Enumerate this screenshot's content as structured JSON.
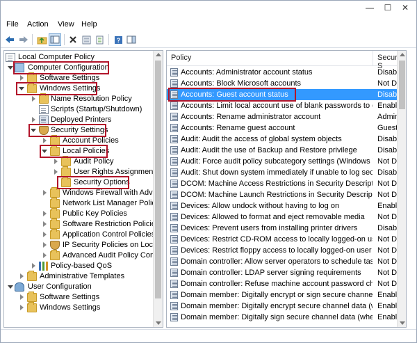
{
  "window": {
    "min_glyph": "—",
    "max_glyph": "☐",
    "close_glyph": "✕"
  },
  "menu": [
    "File",
    "Action",
    "View",
    "Help"
  ],
  "tree": {
    "root": "Local Computer Policy",
    "computer_configuration": "Computer Configuration",
    "software_settings": "Software Settings",
    "windows_settings": "Windows Settings",
    "name_resolution_policy": "Name Resolution Policy",
    "scripts": "Scripts (Startup/Shutdown)",
    "deployed_printers": "Deployed Printers",
    "security_settings": "Security Settings",
    "account_policies": "Account Policies",
    "local_policies": "Local Policies",
    "audit_policy": "Audit Policy",
    "user_rights_assignment": "User Rights Assignment",
    "security_options": "Security Options",
    "windows_firewall": "Windows Firewall with Advan",
    "network_list_manager": "Network List Manager Policie",
    "public_key_policies": "Public Key Policies",
    "software_restriction_policies": "Software Restriction Policies",
    "application_control_policies": "Application Control Policies",
    "ip_security_policies": "IP Security Policies on Local C",
    "advanced_audit_policy": "Advanced Audit Policy Config",
    "policy_based_qos": "Policy-based QoS",
    "administrative_templates": "Administrative Templates",
    "user_configuration": "User Configuration",
    "user_software_settings": "Software Settings",
    "user_windows_settings": "Windows Settings"
  },
  "list": {
    "col_policy": "Policy",
    "col_security": "Security S",
    "rows": [
      {
        "policy": "Accounts: Administrator account status",
        "setting": "Disabled"
      },
      {
        "policy": "Accounts: Block Microsoft accounts",
        "setting": "Not Defir"
      },
      {
        "policy": "Accounts: Guest account status",
        "setting": "Disabled"
      },
      {
        "policy": "Accounts: Limit local account use of blank passwords to co...",
        "setting": "Enabled"
      },
      {
        "policy": "Accounts: Rename administrator account",
        "setting": "Administ"
      },
      {
        "policy": "Accounts: Rename guest account",
        "setting": "Guest"
      },
      {
        "policy": "Audit: Audit the access of global system objects",
        "setting": "Disabled"
      },
      {
        "policy": "Audit: Audit the use of Backup and Restore privilege",
        "setting": "Disabled"
      },
      {
        "policy": "Audit: Force audit policy subcategory settings (Windows Vis...",
        "setting": "Not Defir"
      },
      {
        "policy": "Audit: Shut down system immediately if unable to log secur...",
        "setting": "Disabled"
      },
      {
        "policy": "DCOM: Machine Access Restrictions in Security Descriptor D...",
        "setting": "Not Defir"
      },
      {
        "policy": "DCOM: Machine Launch Restrictions in Security Descriptor ...",
        "setting": "Not Defir"
      },
      {
        "policy": "Devices: Allow undock without having to log on",
        "setting": "Enabled"
      },
      {
        "policy": "Devices: Allowed to format and eject removable media",
        "setting": "Not Defir"
      },
      {
        "policy": "Devices: Prevent users from installing printer drivers",
        "setting": "Disabled"
      },
      {
        "policy": "Devices: Restrict CD-ROM access to locally logged-on user ...",
        "setting": "Not Defir"
      },
      {
        "policy": "Devices: Restrict floppy access to locally logged-on user only",
        "setting": "Not Defir"
      },
      {
        "policy": "Domain controller: Allow server operators to schedule tasks",
        "setting": "Not Defir"
      },
      {
        "policy": "Domain controller: LDAP server signing requirements",
        "setting": "Not Defir"
      },
      {
        "policy": "Domain controller: Refuse machine account password chan...",
        "setting": "Not Defir"
      },
      {
        "policy": "Domain member: Digitally encrypt or sign secure channel d...",
        "setting": "Enabled"
      },
      {
        "policy": "Domain member: Digitally encrypt secure channel data (wh...",
        "setting": "Enabled"
      },
      {
        "policy": "Domain member: Digitally sign secure channel data (when ...",
        "setting": "Enabled"
      }
    ]
  }
}
